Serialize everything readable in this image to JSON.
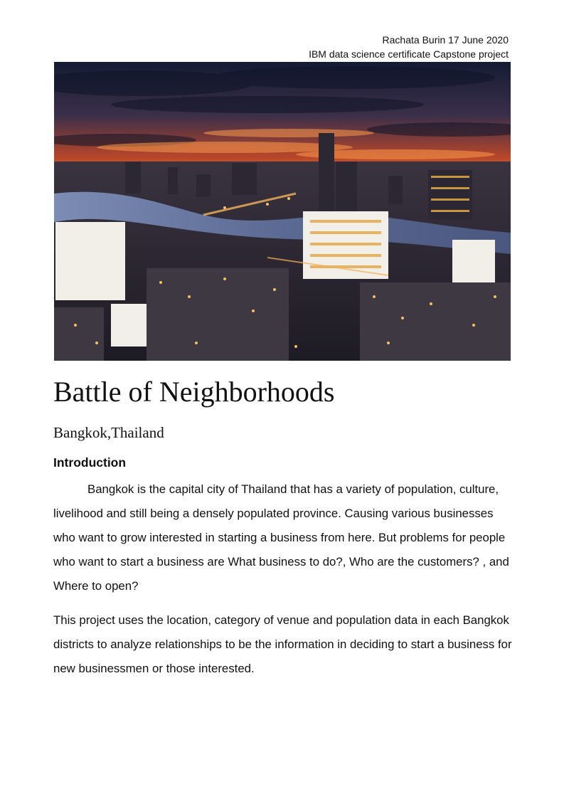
{
  "header": {
    "line1": "Rachata Burin 17 June 2020",
    "line2": "IBM data science certificate Capstone project"
  },
  "image": {
    "description_icon": "city-skyline-photo",
    "colors": {
      "sky_top": "#1a2238",
      "sky_glow": "#e8612a",
      "river": "#6f7fa6",
      "city": "#2a2a35",
      "lights": "#f5c062"
    }
  },
  "document": {
    "title": "Battle of Neighborhoods",
    "subtitle": "Bangkok,Thailand",
    "section_heading": "Introduction",
    "paragraphs": [
      "Bangkok is the capital city of Thailand that has a variety of population, culture, livelihood and still being a densely populated province. Causing various businesses who want to grow interested in starting a business from here. But problems for people who want to start a business are What business to do?, Who are the customers? , and Where to open?",
      "This project uses the location, category of venue and population data in each Bangkok districts to analyze relationships to be the information in deciding to start a business for new businessmen or those interested."
    ]
  }
}
